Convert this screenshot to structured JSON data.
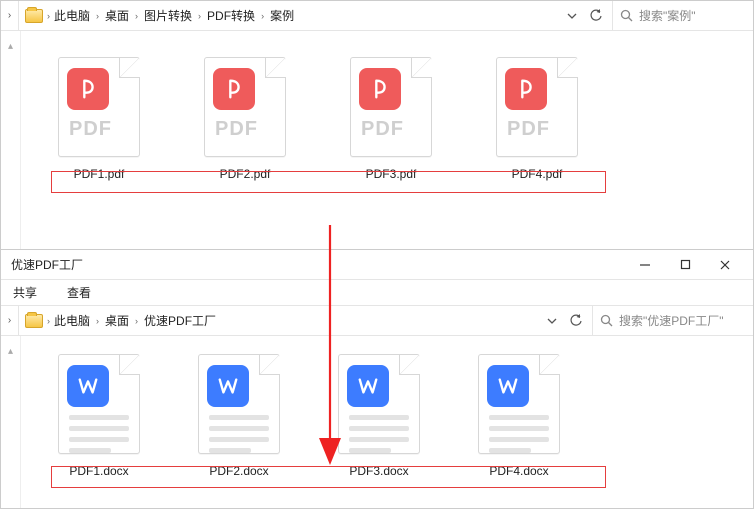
{
  "top": {
    "breadcrumbs": [
      "此电脑",
      "桌面",
      "图片转换",
      "PDF转换",
      "案例"
    ],
    "search_placeholder": "搜索\"案例\"",
    "files": [
      {
        "name": "PDF1.pdf"
      },
      {
        "name": "PDF2.pdf"
      },
      {
        "name": "PDF3.pdf"
      },
      {
        "name": "PDF4.pdf"
      }
    ],
    "type_label": "PDF"
  },
  "bottom": {
    "window_title": "优速PDF工厂",
    "menu": {
      "share": "共享",
      "view": "查看"
    },
    "breadcrumbs": [
      "此电脑",
      "桌面",
      "优速PDF工厂"
    ],
    "search_placeholder": "搜索\"优速PDF工厂\"",
    "files": [
      {
        "name": "PDF1.docx"
      },
      {
        "name": "PDF2.docx"
      },
      {
        "name": "PDF3.docx"
      },
      {
        "name": "PDF4.docx"
      }
    ]
  }
}
